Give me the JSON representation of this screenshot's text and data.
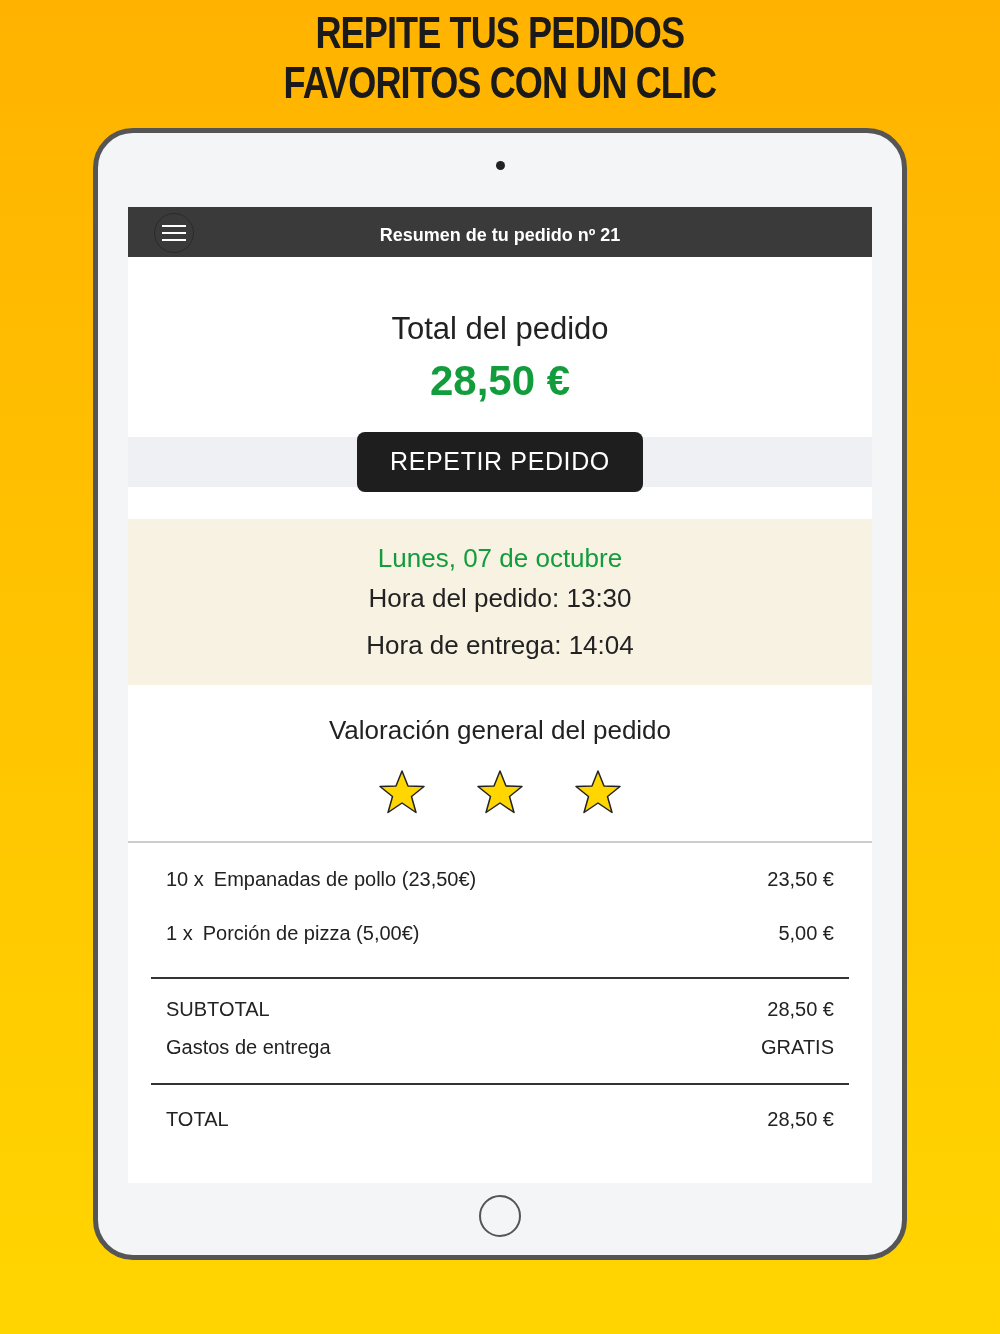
{
  "headline": [
    "REPITE TUS PEDIDOS",
    "FAVORITOS CON UN CLIC"
  ],
  "header": {
    "title": "Resumen de tu pedido nº 21"
  },
  "summary": {
    "label": "Total del pedido",
    "amount": "28,50 €",
    "button": "REPETIR PEDIDO"
  },
  "dates": {
    "day": "Lunes, 07 de octubre",
    "order_time": "Hora del pedido: 13:30",
    "delivery_time": "Hora de entrega: 14:04"
  },
  "rating": {
    "label": "Valoración general del pedido",
    "stars": 3
  },
  "items": [
    {
      "qty": "10 x",
      "name": "Empanadas de pollo (23,50€)",
      "price": "23,50 €"
    },
    {
      "qty": "1 x",
      "name": "Porción de pizza (5,00€)",
      "price": "5,00 €"
    }
  ],
  "totals": [
    {
      "label": "SUBTOTAL",
      "value": "28,50 €"
    },
    {
      "label": "Gastos de entrega",
      "value": "GRATIS"
    }
  ],
  "total": {
    "label": "TOTAL",
    "value": "28,50 €"
  }
}
